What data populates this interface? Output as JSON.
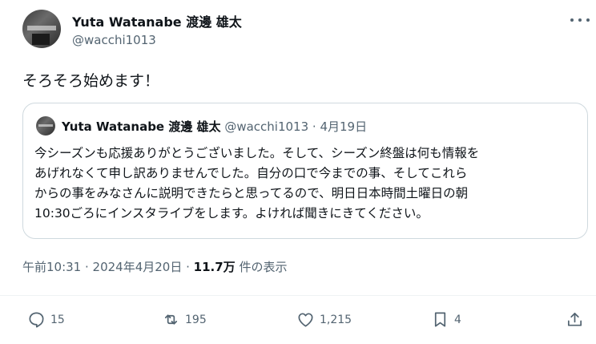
{
  "author": {
    "name": "Yuta Watanabe 渡邊 雄太",
    "handle": "@wacchi1013"
  },
  "tweet": {
    "text": "そろそろ始めます！"
  },
  "quote": {
    "name": "Yuta Watanabe 渡邊 雄太",
    "handle": "@wacchi1013",
    "separator": " · ",
    "date": "4月19日",
    "lines": [
      "今シーズンも応援ありがとうございました。そして、シーズン終盤は何も情報を",
      "あげれなくて申し訳ありませんでした。自分の口で今までの事、そしてこれら",
      "からの事をみなさんに説明できたらと思ってるので、明日日本時間土曜日の朝",
      "10:30ごろにインスタライブをします。よければ聞きにきてください。"
    ]
  },
  "meta": {
    "time": "午前10:31",
    "sep1": " · ",
    "date": "2024年4月20日",
    "sep2": " · ",
    "views": "11.7万",
    "views_label": " 件の表示"
  },
  "actions": {
    "replies": "15",
    "reposts": "195",
    "likes": "1,215",
    "bookmarks": "4"
  },
  "colors": {
    "text": "#0f1419",
    "secondary": "#536471",
    "border": "#cfd9de"
  },
  "icons": [
    "more-icon",
    "reply-icon",
    "repost-icon",
    "like-icon",
    "bookmark-icon",
    "share-icon"
  ]
}
